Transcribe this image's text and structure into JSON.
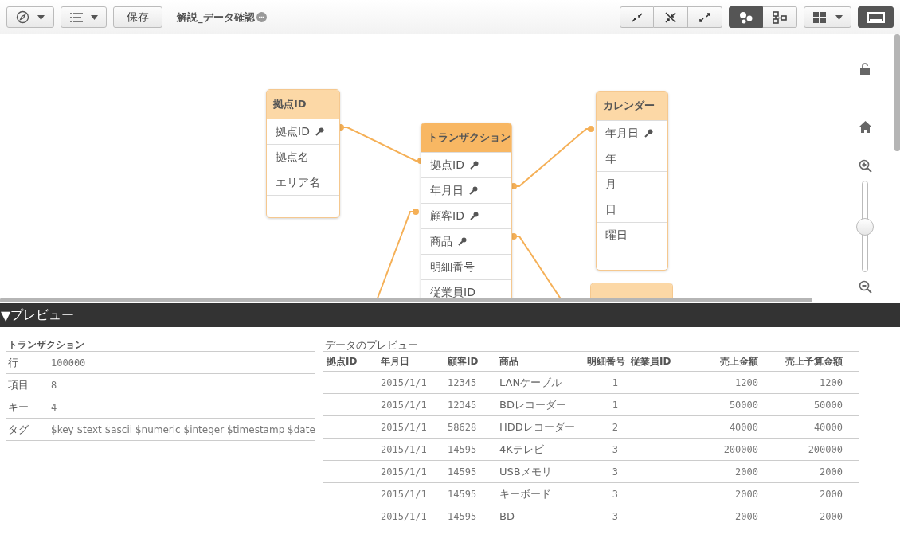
{
  "toolbar": {
    "save_label": "保存",
    "title": "解説_データ確認",
    "view_modes": [
      {
        "kind": "bubbles",
        "selected": true
      },
      {
        "kind": "tree",
        "selected": false
      }
    ],
    "preview_toggle": {
      "on": true
    }
  },
  "canvas": {
    "tables": [
      {
        "name": "拠点ID",
        "selected": false,
        "fields": [
          {
            "name": "拠点ID",
            "key": true
          },
          {
            "name": "拠点名",
            "key": false
          },
          {
            "name": "エリア名",
            "key": false
          }
        ]
      },
      {
        "name": "トランザクション",
        "selected": true,
        "fields": [
          {
            "name": "拠点ID",
            "key": true
          },
          {
            "name": "年月日",
            "key": true
          },
          {
            "name": "顧客ID",
            "key": true
          },
          {
            "name": "商品",
            "key": true
          },
          {
            "name": "明細番号",
            "key": false
          },
          {
            "name": "従業員ID",
            "key": false
          }
        ]
      },
      {
        "name": "カレンダー",
        "selected": false,
        "fields": [
          {
            "name": "年月日",
            "key": true
          },
          {
            "name": "年",
            "key": false
          },
          {
            "name": "月",
            "key": false
          },
          {
            "name": "日",
            "key": false
          },
          {
            "name": "曜日",
            "key": false
          }
        ]
      },
      {
        "selected": false
      }
    ],
    "zoom": {
      "level": 0.5
    }
  },
  "preview": {
    "toggle": "▼",
    "title": "プレビュー",
    "summary": {
      "title": "トランザクション",
      "rows": [
        {
          "label": "行",
          "value": "100000"
        },
        {
          "label": "項目",
          "value": "8"
        },
        {
          "label": "キー",
          "value": "4"
        },
        {
          "label": "タグ",
          "value": "$key $text $ascii $numeric $integer $timestamp $date"
        }
      ]
    },
    "data": {
      "title": "データのプレビュー",
      "columns": [
        "拠点ID",
        "年月日",
        "顧客ID",
        "商品",
        "明細番号",
        "従業員ID",
        "売上金額",
        "売上予算金額"
      ],
      "rows": [
        [
          null,
          "2015/1/1",
          "12345",
          "LANケーブル",
          "1",
          null,
          "1200",
          "1200"
        ],
        [
          null,
          "2015/1/1",
          "12345",
          "BDレコーダー",
          "1",
          null,
          "50000",
          "50000"
        ],
        [
          null,
          "2015/1/1",
          "58628",
          "HDDレコーダー",
          "2",
          null,
          "40000",
          "40000"
        ],
        [
          null,
          "2015/1/1",
          "14595",
          "4Kテレビ",
          "3",
          null,
          "200000",
          "200000"
        ],
        [
          null,
          "2015/1/1",
          "14595",
          "USBメモリ",
          "3",
          null,
          "2000",
          "2000"
        ],
        [
          null,
          "2015/1/1",
          "14595",
          "キーボード",
          "3",
          null,
          "2000",
          "2000"
        ],
        [
          null,
          "2015/1/1",
          "14595",
          "BD",
          "3",
          null,
          "2000",
          "2000"
        ]
      ]
    }
  }
}
